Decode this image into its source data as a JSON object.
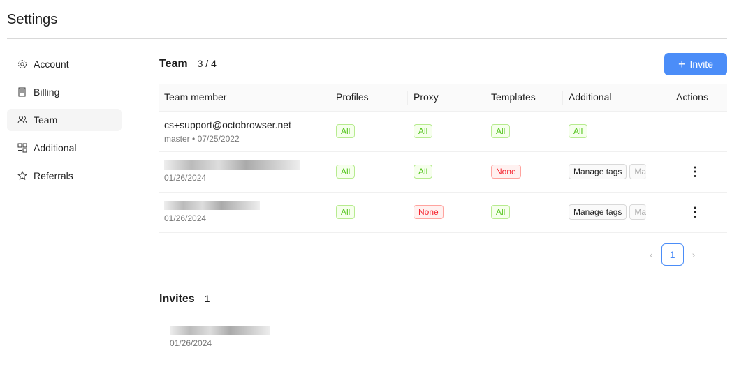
{
  "title": "Settings",
  "sidebar": {
    "items": [
      {
        "label": "Account",
        "icon": "gear-icon"
      },
      {
        "label": "Billing",
        "icon": "receipt-icon"
      },
      {
        "label": "Team",
        "icon": "team-icon",
        "active": true
      },
      {
        "label": "Additional",
        "icon": "apps-icon"
      },
      {
        "label": "Referrals",
        "icon": "star-icon"
      }
    ]
  },
  "team": {
    "title": "Team",
    "count": "3 / 4",
    "invite_label": "Invite",
    "columns": [
      "Team member",
      "Profiles",
      "Proxy",
      "Templates",
      "Additional",
      "Actions"
    ],
    "rows": [
      {
        "member": "cs+support@octobrowser.net",
        "role": "master",
        "date": "07/25/2022",
        "profiles": "All",
        "proxy": "All",
        "templates": "All",
        "additional": "All"
      },
      {
        "member": "",
        "date": "01/26/2024",
        "profiles": "All",
        "proxy": "All",
        "templates": "None",
        "tag1": "Manage tags",
        "tag2": "Ma"
      },
      {
        "member": "",
        "date": "01/26/2024",
        "profiles": "All",
        "proxy": "None",
        "templates": "All",
        "tag1": "Manage tags",
        "tag2": "Ma"
      }
    ],
    "page": "1"
  },
  "invites": {
    "title": "Invites",
    "count": "1",
    "items": [
      {
        "date": "01/26/2024"
      }
    ]
  },
  "colors": {
    "accent": "#4b8df8",
    "green": "#52c41a",
    "red": "#f5222d"
  }
}
